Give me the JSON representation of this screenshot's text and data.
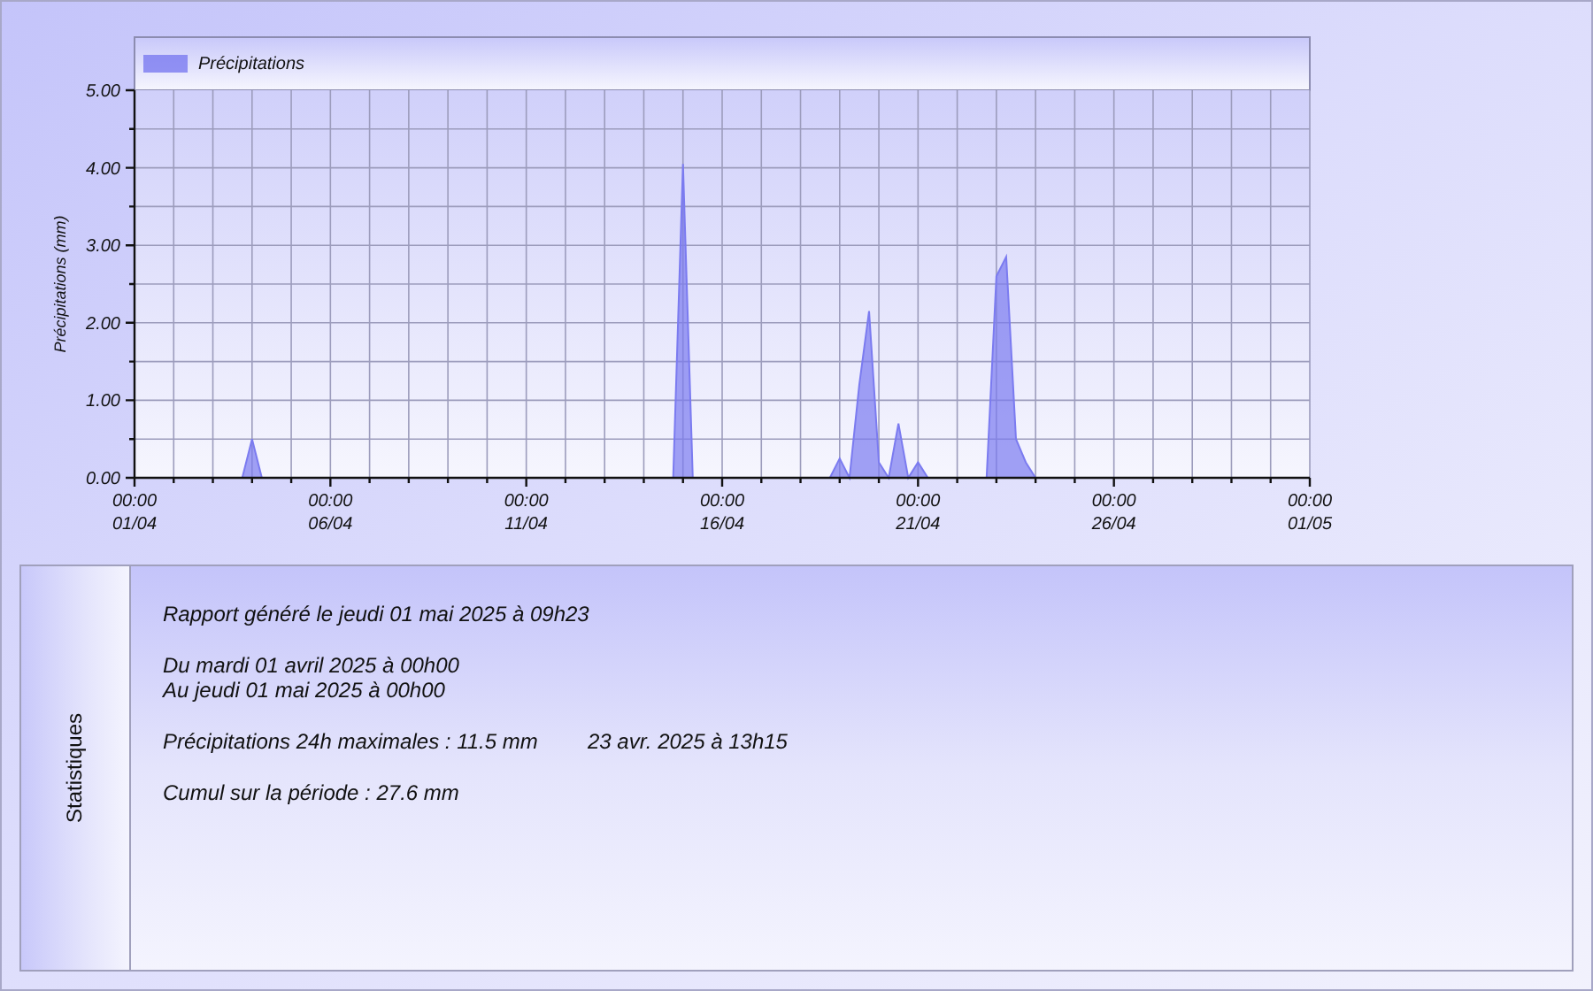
{
  "chart": {
    "chart_data": {
      "type": "area",
      "ylabel": "Précipitations (mm)",
      "categories": [
        "00:00\n01/04",
        null,
        null,
        null,
        null,
        null,
        null,
        null,
        null,
        null,
        null,
        null,
        null,
        null,
        null,
        null,
        null,
        null,
        null,
        null,
        "00:00\n06/04",
        null,
        null,
        null,
        null,
        null,
        null,
        null,
        null,
        null,
        null,
        null,
        null,
        null,
        null,
        null,
        null,
        null,
        null,
        null,
        "00:00\n11/04",
        null,
        null,
        null,
        null,
        null,
        null,
        null,
        null,
        null,
        null,
        null,
        null,
        null,
        null,
        null,
        null,
        null,
        null,
        null,
        "00:00\n16/04",
        null,
        null,
        null,
        null,
        null,
        null,
        null,
        null,
        null,
        null,
        null,
        null,
        null,
        null,
        null,
        null,
        null,
        null,
        null,
        "00:00\n21/04",
        null,
        null,
        null,
        null,
        null,
        null,
        null,
        null,
        null,
        null,
        null,
        null,
        null,
        null,
        null,
        null,
        null,
        null,
        null,
        "00:00\n26/04",
        null,
        null,
        null,
        null,
        null,
        null,
        null,
        null,
        null,
        null,
        null,
        null,
        null,
        null,
        null,
        null,
        null,
        null,
        null,
        "00:00\n01/05"
      ],
      "series": [
        {
          "name": "Précipitations",
          "color": "#7b7bf0",
          "values": [
            0,
            0,
            0,
            0,
            0,
            0,
            0,
            0,
            0,
            0,
            0,
            0,
            0.5,
            0,
            0,
            0,
            0,
            0,
            0,
            0,
            0,
            0,
            0,
            0,
            0,
            0,
            0,
            0,
            0,
            0,
            0,
            0,
            0,
            0,
            0,
            0,
            0,
            0,
            0,
            0,
            0,
            0,
            0,
            0,
            0,
            0,
            0,
            0,
            0,
            0,
            0,
            0,
            0,
            0,
            0,
            0,
            4.05,
            0,
            0,
            0,
            0,
            0,
            0,
            0,
            0,
            0,
            0,
            0,
            0,
            0,
            0,
            0,
            0.25,
            0,
            1.2,
            2.15,
            0.2,
            0,
            0.7,
            0,
            0.2,
            0,
            0,
            0,
            0,
            0,
            0,
            0,
            2.6,
            2.85,
            0.5,
            0.2,
            0,
            0,
            0,
            0,
            0,
            0,
            0,
            0,
            0,
            0,
            0,
            0,
            0,
            0,
            0,
            0,
            0,
            0,
            0,
            0,
            0,
            0,
            0,
            0,
            0,
            0,
            0,
            0,
            0
          ]
        }
      ],
      "ylim": [
        0,
        5
      ],
      "grid": true,
      "yticks": [
        {
          "value": 0,
          "label": "0.00"
        },
        {
          "value": 1,
          "label": "1.00"
        },
        {
          "value": 2,
          "label": "2.00"
        },
        {
          "value": 3,
          "label": "3.00"
        },
        {
          "value": 4,
          "label": "4.00"
        },
        {
          "value": 5,
          "label": "5.00"
        }
      ]
    }
  },
  "stats": {
    "tab_label": "Statistiques",
    "paragraphs": [
      [
        {
          "text": "Rapport généré le jeudi 01 mai 2025 à 09h23"
        }
      ],
      [
        {
          "text": "Du mardi 01 avril 2025 à 00h00"
        },
        {
          "text": "Au jeudi 01 mai 2025 à 00h00"
        }
      ],
      [
        {
          "text": "Précipitations 24h maximales : 11.5 mm",
          "aside": "23 avr. 2025 à 13h15"
        }
      ],
      [
        {
          "text": "Cumul sur la période : 27.6 mm"
        }
      ]
    ]
  }
}
